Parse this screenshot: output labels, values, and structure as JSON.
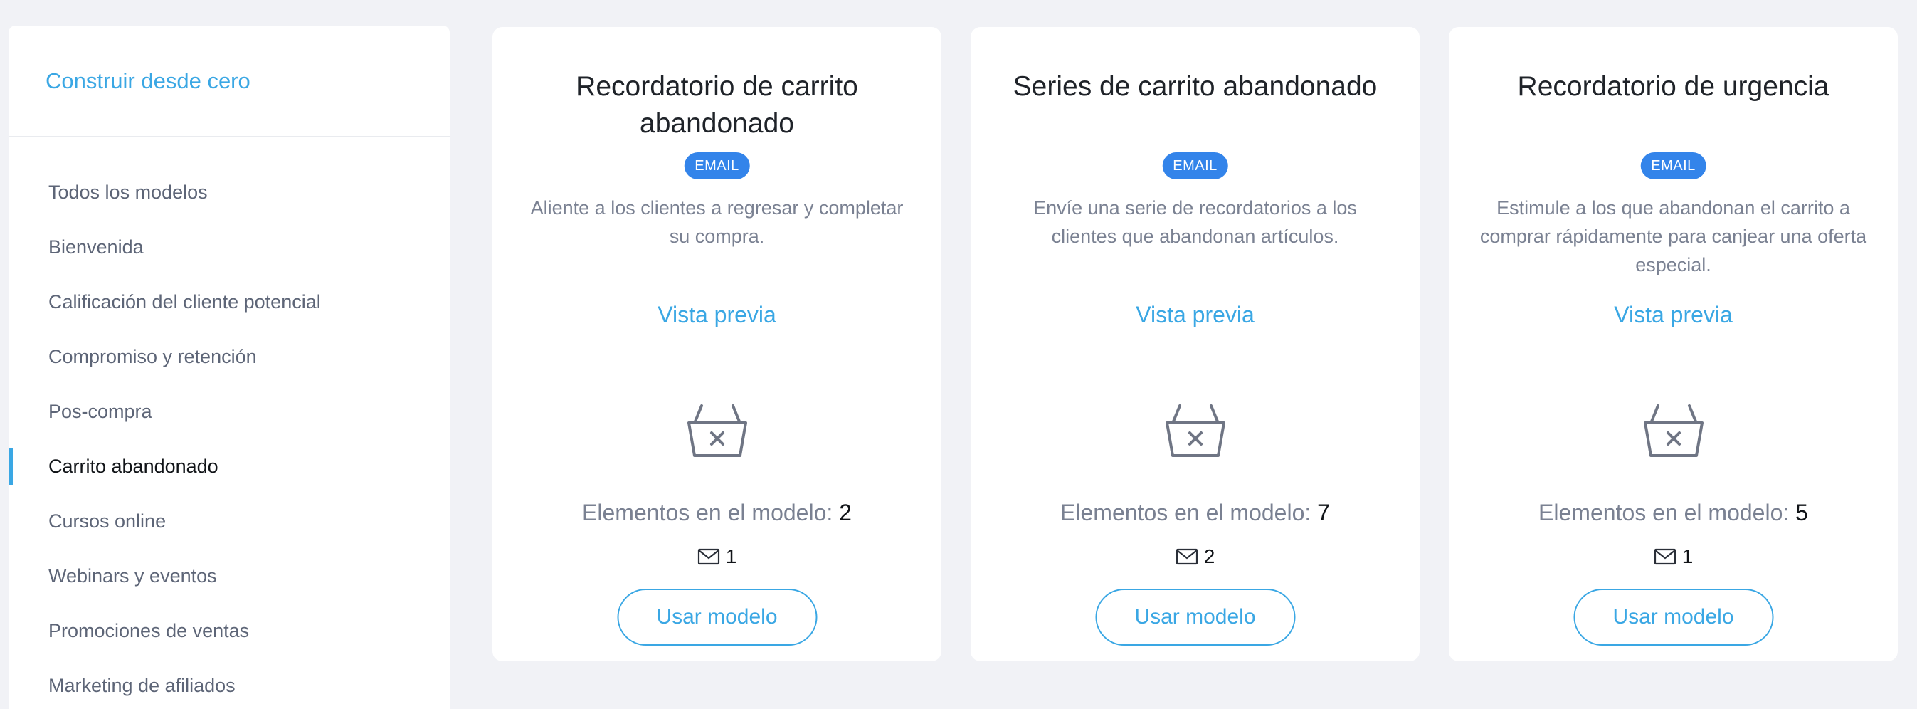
{
  "sidebar": {
    "build_from_scratch": "Construir desde cero",
    "items": [
      {
        "label": "Todos los modelos",
        "active": false
      },
      {
        "label": "Bienvenida",
        "active": false
      },
      {
        "label": "Calificación del cliente potencial",
        "active": false
      },
      {
        "label": "Compromiso y retención",
        "active": false
      },
      {
        "label": "Pos-compra",
        "active": false
      },
      {
        "label": "Carrito abandonado",
        "active": true
      },
      {
        "label": "Cursos online",
        "active": false
      },
      {
        "label": "Webinars y eventos",
        "active": false
      },
      {
        "label": "Promociones de ventas",
        "active": false
      },
      {
        "label": "Marketing de afiliados",
        "active": false
      }
    ]
  },
  "cards": [
    {
      "title": "Recordatorio de carrito abandonado",
      "badge": "EMAIL",
      "description": "Aliente a los clientes a regresar y completar su compra.",
      "preview": "Vista previa",
      "icon": "abandoned-basket-icon",
      "elements_label": "Elementos en el modelo:",
      "elements_count": "2",
      "email_count": "1",
      "button": "Usar modelo"
    },
    {
      "title": "Series de carrito abandonado",
      "badge": "EMAIL",
      "description": "Envíe una serie de recordatorios a los clientes que abandonan artículos.",
      "preview": "Vista previa",
      "icon": "abandoned-basket-icon",
      "elements_label": "Elementos en el modelo:",
      "elements_count": "7",
      "email_count": "2",
      "button": "Usar modelo"
    },
    {
      "title": "Recordatorio de urgencia",
      "badge": "EMAIL",
      "description": "Estimule a los que abandonan el carrito a comprar rápidamente para canjear una oferta especial.",
      "preview": "Vista previa",
      "icon": "abandoned-basket-icon",
      "elements_label": "Elementos en el modelo:",
      "elements_count": "5",
      "email_count": "1",
      "button": "Usar modelo"
    }
  ],
  "colors": {
    "accent": "#3aa7e4",
    "badge": "#3384ea",
    "background": "#f1f2f6",
    "muted_text": "#7a8192"
  }
}
